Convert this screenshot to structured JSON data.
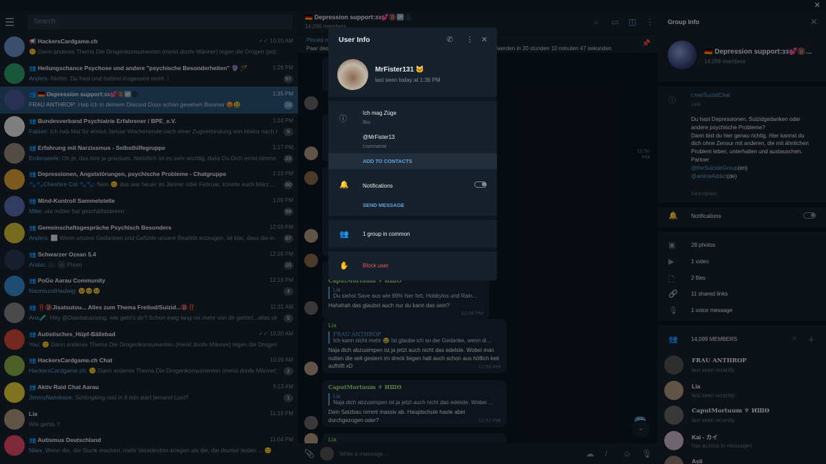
{
  "window": {
    "close_icon": "close-icon"
  },
  "left": {
    "search_placeholder": "Search",
    "chats": [
      {
        "name": "📢 HackersCardgame.ch",
        "sender": "",
        "preview": "🙁 Dann anderes Thema Die Drogenkonsumenten (meist doofe Männer) legen die Drogen (jed...",
        "time": "10:20 AM",
        "badge": "",
        "read": "✓✓",
        "color": "#6a8fc7"
      },
      {
        "name": "👥 Heilungschance Psychose und andere \"psychische Besonderheiten\" 🔮 🪄 🌙",
        "sender": "Anders:",
        "preview": "Nichts. Du hast und hattest insgesamt recht. 🕯",
        "time": "1:26 PM",
        "badge": "57",
        "read": "",
        "color": "#2e9e6b"
      },
      {
        "name": "👥 🇩🇪 Depression support:ɜɜ💕🔞🆙🌑",
        "sender": "FRAU ANTHROP:",
        "preview": "Hab ich in deinem Discord Doxx schon gesehen Boomer 😡🤮",
        "time": "1:35 PM",
        "badge": "28",
        "read": "",
        "color": "#4b5a9a"
      },
      {
        "name": "👥 Bundesverband Psychiatrie Erfahrener / BPE_e.V.",
        "sender": "Fabian:",
        "preview": "Ich hab Mal für erstes Januar Wochenende nach einer Zugverbindung von Mainz nach B...",
        "time": "1:24 PM",
        "badge": "9",
        "read": "",
        "color": "#e8e8e8"
      },
      {
        "name": "👥 Erfahrung mit Narzissmus - Selbsthilfegruppe",
        "sender": "Erdenseele:",
        "preview": "Oh je, das tönt ja grausam.  Natürlich ist es sehr wichtig, dass Du Dich ernst nimms...",
        "time": "1:17 PM",
        "badge": "23",
        "read": "",
        "color": "#9a8c7e"
      },
      {
        "name": "👥 Depressionen, Angststörungen, psychische Probleme - Chatgruppe",
        "sender": "🐾🐾Cheshire Cat 🐾🐾:",
        "preview": "Nein 😊 das war heuer im Jänner oder Februar, könnte auch März ...",
        "time": "1:13 PM",
        "badge": "60",
        "read": "",
        "color": "#e0a23a"
      },
      {
        "name": "👥 Mind-Kontroll Sammelstelle",
        "sender": "Mike:",
        "preview": "uta möller hat geschäftsideeen .",
        "time": "1:09 PM",
        "badge": "59",
        "read": "",
        "color": "#5a6fb0"
      },
      {
        "name": "👥 Gemeinschaftsgespräche Psychisch Besonders",
        "sender": "Anders:",
        "preview": "⬜ Wenn unsere Gedanken und Gefühle unsere Realität erzeugen, ist klar, dass die in...",
        "time": "12:59 PM",
        "badge": "67",
        "read": "",
        "color": "#d8c23a"
      },
      {
        "name": "👥 Schwarzer Ozean 5.4",
        "sender": "Arabic 🌑:",
        "preview": "🖼 Photo",
        "time": "12:28 PM",
        "badge": "10",
        "read": "",
        "color": "#2a3a5a"
      },
      {
        "name": "👥 PoGo Aarau Community",
        "sender": "NaomiundHedwig:",
        "preview": "🥺🥺🥺",
        "time": "12:19 PM",
        "badge": "3",
        "read": "",
        "color": "#3a8ad0"
      },
      {
        "name": "👥 ‼️🔞Jisatsutou... Alles zum Thema Freitod/Suizid...🔞‼️",
        "sender": "Ana🧪:",
        "preview": "Hey @Daedalusrising, wie geht's dir? Schon ewig lang nix mehr von dir gehört...alles ok...",
        "time": "11:31 AM",
        "badge": "5",
        "read": "",
        "color": "#888888"
      },
      {
        "name": "👥 Autistisches_Hüpf-Bällebad",
        "sender": "You:",
        "preview": "🙁 Dann anderes Thema Die Drogenkonsumenten (meist doofe Männer) legen die Drogen (jed...",
        "time": "10:20 AM",
        "badge": "",
        "read": "✓✓",
        "color": "#d04a3a"
      },
      {
        "name": "👥 HackersCardgame.ch Chat",
        "sender": "HackersCardgame.ch:",
        "preview": "🙁 Dann anderes Thema Die Drogenkonsumenten (meist doofe Männer) legen die Drogen (jed...",
        "time": "10:20 AM",
        "badge": "2",
        "read": "",
        "color": "#8ab04a"
      },
      {
        "name": "👥 Aktiv Raid Chat Aarau",
        "sender": "JimmyNamikaze:",
        "preview": "Schlingking raid in 8 min start jemand Lust?",
        "time": "9:13 AM",
        "badge": "1",
        "read": "",
        "color": "#e8d23a"
      },
      {
        "name": "Lia",
        "sender": "",
        "preview": "Wie gehts ?",
        "time": "11:16 PM",
        "badge": "",
        "read": "",
        "color": "#b09a80"
      },
      {
        "name": "👥 Autismus Deutschland",
        "sender": "Nilex:",
        "preview": "Wenn die, die Stunk machen, mehr Verständnis kriegen als die, die drunter leiden ... 🙁",
        "time": "11:04 PM",
        "badge": "",
        "read": "",
        "color": "#e84a6a"
      }
    ]
  },
  "mid": {
    "title": "🇩🇪 Depression support:ɜɜ💕🔞🆙🌑",
    "subtitle": "14,099 members",
    "pinned_label": "Pinned m",
    "pinned_text": "Paar des... werden in 20 stunden 10 minuten 47 sekunden",
    "pinned_prefix": "Paar des",
    "pinned_suffix": "werden in 20 stunden 10 minuten 47 sekunden",
    "messages": [
      {
        "author": "CaputMortuum ♆ ИШӨ",
        "reply_name": "Lia",
        "reply_text": "Du siehst Save aus wie 99% hier fett, Hobbylos und Rain...",
        "text": "Hahahah das glaubst auch nur du kann das sein?",
        "time": "12:56 PM"
      },
      {
        "author": "Lia",
        "reply_name": "FRAU ANTHROP",
        "reply_text": "Ich kann nicht mehr 😂 Ist glaube ich so der Gedanke, wenn di...",
        "text": "Naja dich abzusimpen ist ja jetzt auch nicht das edelste. Wobei man nutten die seit gestern im dreck liegen halt auch schon aus höflich keit aufhilft xD",
        "time": "12:56 PM"
      },
      {
        "author": "CaputMortuum ♆ ИШӨ",
        "reply_name": "Lia",
        "reply_text": "Naja dich abzusimpen ist ja jetzt auch nicht das edelste. Wobei ...",
        "text": "Dein Satzbau nimmt massiv ab. Hauptschule haste aber durchgezogen oder?",
        "time": "12:57 PM"
      },
      {
        "author": "Lia",
        "reply_name": "",
        "reply_text": "",
        "text": "",
        "time": ""
      }
    ],
    "partial_times": [
      "12:50 PM"
    ],
    "unread_count": "24",
    "composer_placeholder": "Write a message..."
  },
  "right": {
    "title": "Group Info",
    "group_name": "🇩🇪 Depression support:ɜɜ💕🔞...",
    "group_members": "14,099 members",
    "link": "t.me/SuizidChat",
    "link_label": "Link",
    "description": "Du hast Depressionen, Suizidgedanken oder andere psychische Probleme?\nDann bist du hier genau richtig. Hier kannst du dich ohne Zensur mit anderen, die mit ähnlichen Problem leben, unterhalten und austauschen.\nPartner",
    "partner1": "@theSuicideGroup",
    "partner1_suffix": "(en)",
    "partner2": "@animeAddict",
    "partner2_suffix": "(de)",
    "description_label": "Description",
    "notifications": "Notifications",
    "media": [
      "28 photos",
      "1 video",
      "2 files",
      "11 shared links",
      "1 voice message"
    ],
    "members_header": "14,099 MEMBERS",
    "members": [
      {
        "name": "FRAU ANTHROP",
        "status": "last seen recently",
        "color": "#555555"
      },
      {
        "name": "Lia",
        "status": "last seen recently",
        "color": "#b09a80"
      },
      {
        "name": "CaputMortuum ♆ ИШӨ",
        "status": "last seen recently",
        "color": "#666666"
      },
      {
        "name": "Kai - カイ",
        "status": "has access to messages",
        "color": "#c8b8c8"
      },
      {
        "name": "Asli",
        "status": "",
        "color": "#8a7a6a"
      }
    ]
  },
  "modal": {
    "title": "User Info",
    "user_name": "MrFister131 🐱",
    "last_seen": "last seen today at 1:36 PM",
    "bio": "Ich mag Züge",
    "bio_label": "Bio",
    "username": "@MrFister13",
    "username_label": "Username",
    "add_contacts": "ADD TO CONTACTS",
    "notifications": "Notifications",
    "send_message": "SEND MESSAGE",
    "groups_common": "1 group in common",
    "block": "Block user"
  },
  "icons": {
    "phone": "phone-icon",
    "more": "more-icon",
    "close": "close-icon",
    "info": "info-icon",
    "bell": "bell-icon",
    "group": "group-icon",
    "block": "block-icon",
    "search": "search-icon",
    "menu": "menu-icon",
    "attach": "attach-icon",
    "emoji": "emoji-icon",
    "mic": "mic-icon"
  },
  "colors": {
    "accent": "#5fa3d9",
    "active_chat": "#2b5278",
    "danger": "#e05d5d",
    "panel": "#17212b",
    "background": "#0e1621"
  }
}
